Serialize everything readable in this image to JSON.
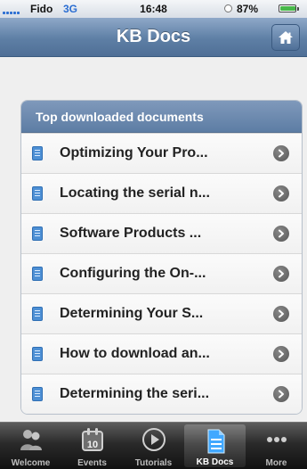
{
  "status_bar": {
    "carrier": "Fido",
    "network": "3G",
    "time": "16:48",
    "battery": "87%"
  },
  "nav": {
    "title": "KB Docs",
    "home_icon": "home-icon"
  },
  "panel": {
    "title": "Top downloaded documents",
    "documents": [
      {
        "label": "Optimizing Your Pro..."
      },
      {
        "label": "Locating the serial n..."
      },
      {
        "label": "Software Products ..."
      },
      {
        "label": "Configuring the On-..."
      },
      {
        "label": "Determining Your S..."
      },
      {
        "label": "How to download an..."
      },
      {
        "label": "Determining the seri..."
      }
    ]
  },
  "tabs": [
    {
      "label": "Welcome",
      "icon": "welcome-icon",
      "active": false
    },
    {
      "label": "Events",
      "icon": "calendar-icon",
      "active": false,
      "date": "10"
    },
    {
      "label": "Tutorials",
      "icon": "play-icon",
      "active": false
    },
    {
      "label": "KB Docs",
      "icon": "document-icon",
      "active": true
    },
    {
      "label": "More",
      "icon": "more-icon",
      "active": false
    }
  ],
  "colors": {
    "nav_bar": "#5e7fa5",
    "accent": "#2b6ed2",
    "battery": "#47b84a"
  }
}
